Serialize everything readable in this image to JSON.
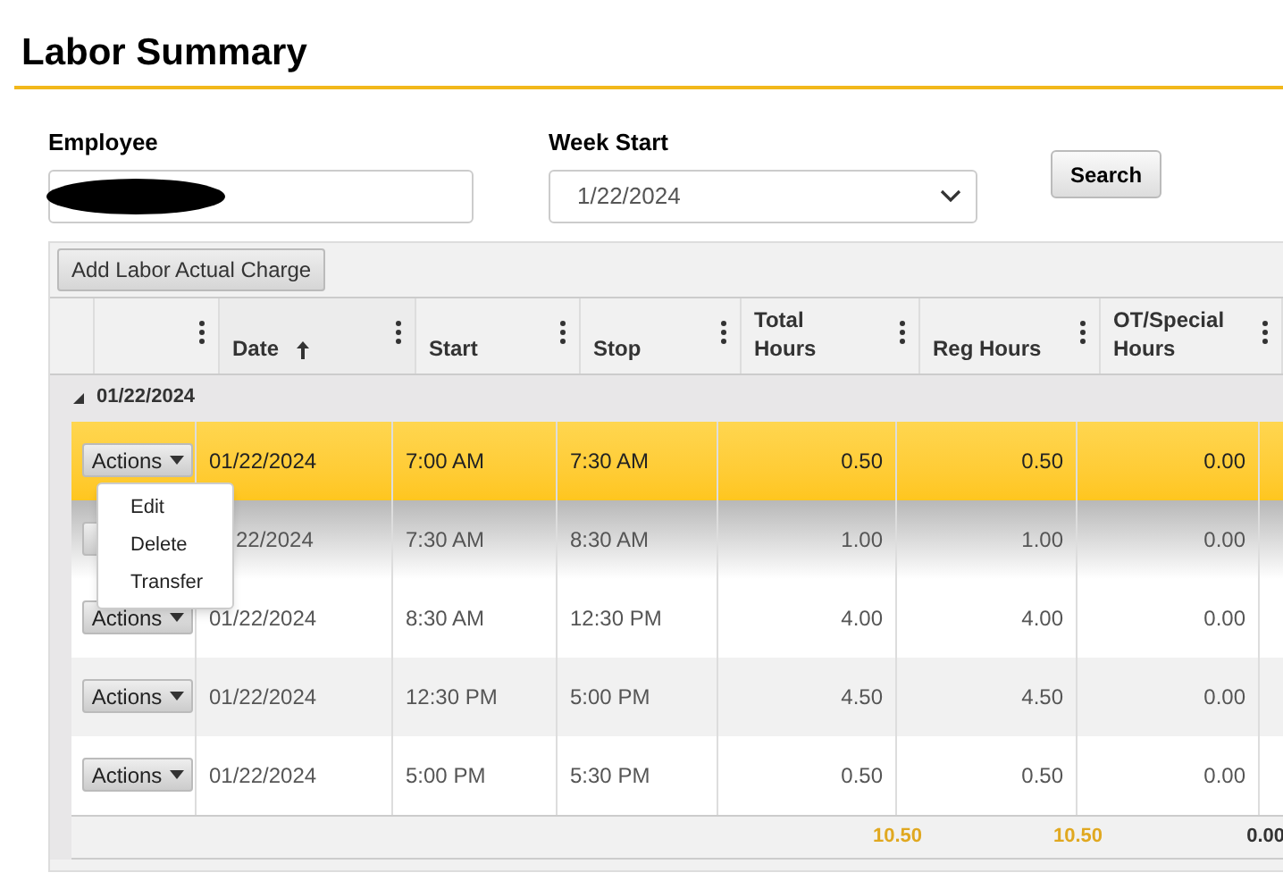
{
  "page_title": "Labor Summary",
  "filters": {
    "employee_label": "Employee",
    "week_label": "Week Start",
    "week_value": "1/22/2024",
    "search_button": "Search"
  },
  "toolbar": {
    "add_button": "Add Labor Actual Charge"
  },
  "columns": [
    {
      "sorted": false
    },
    {
      "label": "Date",
      "sorted": true
    },
    {
      "label": "Start",
      "sorted": false
    },
    {
      "label": "Stop",
      "sorted": false
    },
    {
      "label": "Total Hours",
      "sorted": false
    },
    {
      "label": "Reg Hours",
      "sorted": false
    },
    {
      "label": "OT/Special Hours",
      "sorted": false
    }
  ],
  "group": {
    "label": "01/22/2024",
    "expanded": true
  },
  "rows": [
    {
      "actions": "Actions",
      "date": "01/22/2024",
      "start": "7:00 AM",
      "stop": "7:30 AM",
      "total": "0.50",
      "reg": "0.50",
      "ot": "0.00",
      "selected": true,
      "menu_open": true
    },
    {
      "date": "22/2024",
      "start": "7:30 AM",
      "stop": "8:30 AM",
      "total": "1.00",
      "reg": "1.00",
      "ot": "0.00",
      "selected": false,
      "menu_open": false
    },
    {
      "actions": "Actions",
      "date": "01/22/2024",
      "start": "8:30 AM",
      "stop": "12:30 PM",
      "total": "4.00",
      "reg": "4.00",
      "ot": "0.00",
      "selected": false,
      "menu_open": false
    },
    {
      "actions": "Actions",
      "date": "01/22/2024",
      "start": "12:30 PM",
      "stop": "5:00 PM",
      "total": "4.50",
      "reg": "4.50",
      "ot": "0.00",
      "selected": false,
      "menu_open": false
    },
    {
      "actions": "Actions",
      "date": "01/22/2024",
      "start": "5:00 PM",
      "stop": "5:30 PM",
      "total": "0.50",
      "reg": "0.50",
      "ot": "0.00",
      "selected": false,
      "menu_open": false
    }
  ],
  "actions_menu": [
    "Edit",
    "Delete",
    "Transfer"
  ],
  "totals": {
    "total": "10.50",
    "reg": "10.50",
    "ot": "0.00"
  }
}
